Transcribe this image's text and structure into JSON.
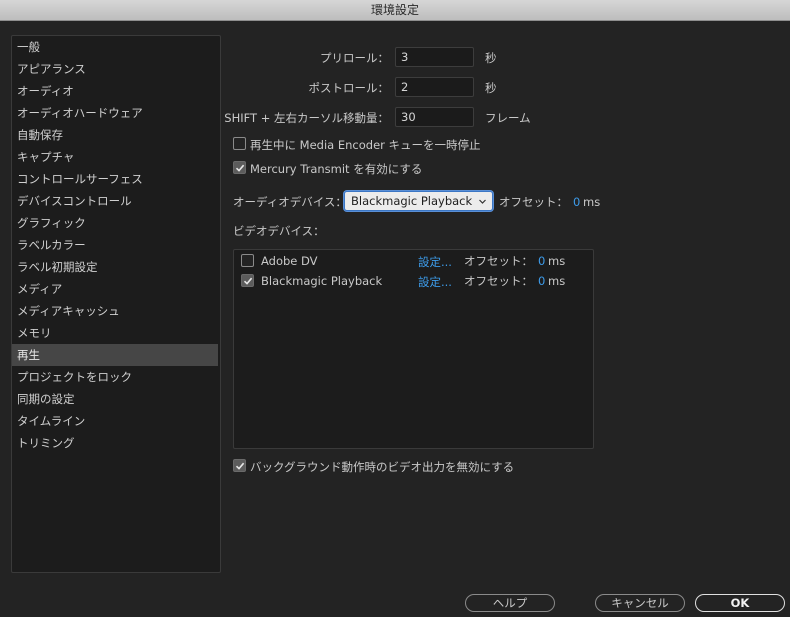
{
  "window": {
    "title": "環境設定"
  },
  "sidebar": {
    "items": [
      {
        "label": "一般"
      },
      {
        "label": "アピアランス"
      },
      {
        "label": "オーディオ"
      },
      {
        "label": "オーディオハードウェア"
      },
      {
        "label": "自動保存"
      },
      {
        "label": "キャプチャ"
      },
      {
        "label": "コントロールサーフェス"
      },
      {
        "label": "デバイスコントロール"
      },
      {
        "label": "グラフィック"
      },
      {
        "label": "ラベルカラー"
      },
      {
        "label": "ラベル初期設定"
      },
      {
        "label": "メディア"
      },
      {
        "label": "メディアキャッシュ"
      },
      {
        "label": "メモリ"
      },
      {
        "label": "再生"
      },
      {
        "label": "プロジェクトをロック"
      },
      {
        "label": "同期の設定"
      },
      {
        "label": "タイムライン"
      },
      {
        "label": "トリミング"
      }
    ],
    "selected": "再生"
  },
  "playback": {
    "preroll_label": "プリロール：",
    "preroll_value": "3",
    "preroll_unit": "秒",
    "postroll_label": "ポストロール：",
    "postroll_value": "2",
    "postroll_unit": "秒",
    "shift_label": "SHIFT + 左右カーソル移動量：",
    "shift_value": "30",
    "shift_unit": "フレーム",
    "pause_encoder_label": "再生中に Media Encoder キューを一時停止",
    "pause_encoder_checked": false,
    "mercury_label": "Mercury Transmit を有効にする",
    "mercury_checked": true
  },
  "audio": {
    "device_label": "オーディオデバイス：",
    "device_value": "Blackmagic Playback",
    "offset_label": "オフセット：",
    "offset_value": "0",
    "offset_unit": "ms"
  },
  "video": {
    "device_label": "ビデオデバイス：",
    "devices": [
      {
        "name": "Adobe DV",
        "checked": false,
        "settings": "設定...",
        "offset_label": "オフセット：",
        "offset_value": "0",
        "offset_unit": "ms"
      },
      {
        "name": "Blackmagic Playback",
        "checked": true,
        "settings": "設定...",
        "offset_label": "オフセット：",
        "offset_value": "0",
        "offset_unit": "ms"
      }
    ]
  },
  "background": {
    "label": "バックグラウンド動作時のビデオ出力を無効にする",
    "checked": true
  },
  "buttons": {
    "help": "ヘルプ",
    "cancel": "キャンセル",
    "ok": "OK"
  },
  "colors": {
    "accent": "#3d9be9",
    "selection": "#464646",
    "panel_bg": "#232323"
  }
}
